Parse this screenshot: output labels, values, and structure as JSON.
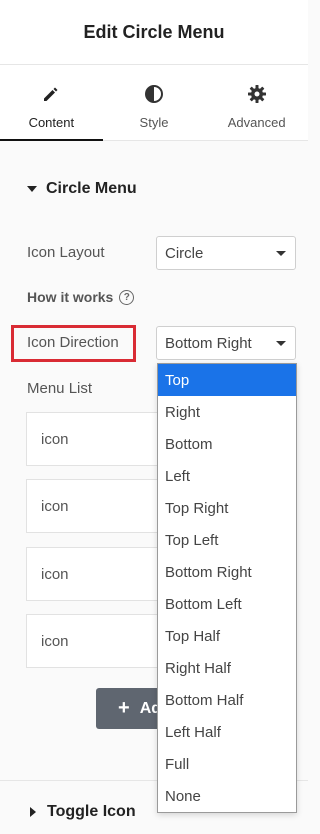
{
  "header": {
    "title": "Edit Circle Menu"
  },
  "tabs": [
    {
      "label": "Content",
      "icon": "pencil-icon",
      "active": true
    },
    {
      "label": "Style",
      "icon": "contrast-icon",
      "active": false
    },
    {
      "label": "Advanced",
      "icon": "gear-icon",
      "active": false
    }
  ],
  "section": {
    "title": "Circle Menu"
  },
  "fields": {
    "icon_layout": {
      "label": "Icon Layout",
      "value": "Circle"
    },
    "how_it_works": {
      "label": "How it works",
      "help_icon": "?"
    },
    "icon_direction": {
      "label": "Icon Direction",
      "value": "Bottom Right"
    }
  },
  "menu_list": {
    "label": "Menu List",
    "items": [
      "icon",
      "icon",
      "icon",
      "icon"
    ]
  },
  "add_button": {
    "label": "Add Item",
    "visible_label": "Ad",
    "icon": "plus-icon"
  },
  "toggle_section": {
    "title": "Toggle Icon"
  },
  "dropdown": {
    "selected": "Top",
    "options": [
      "Top",
      "Right",
      "Bottom",
      "Left",
      "Top Right",
      "Top Left",
      "Bottom Right",
      "Bottom Left",
      "Top Half",
      "Right Half",
      "Bottom Half",
      "Left Half",
      "Full",
      "None"
    ]
  },
  "colors": {
    "highlight_border": "#d92b34",
    "selected_option": "#1a73e8",
    "add_button_bg": "#5f6670"
  }
}
